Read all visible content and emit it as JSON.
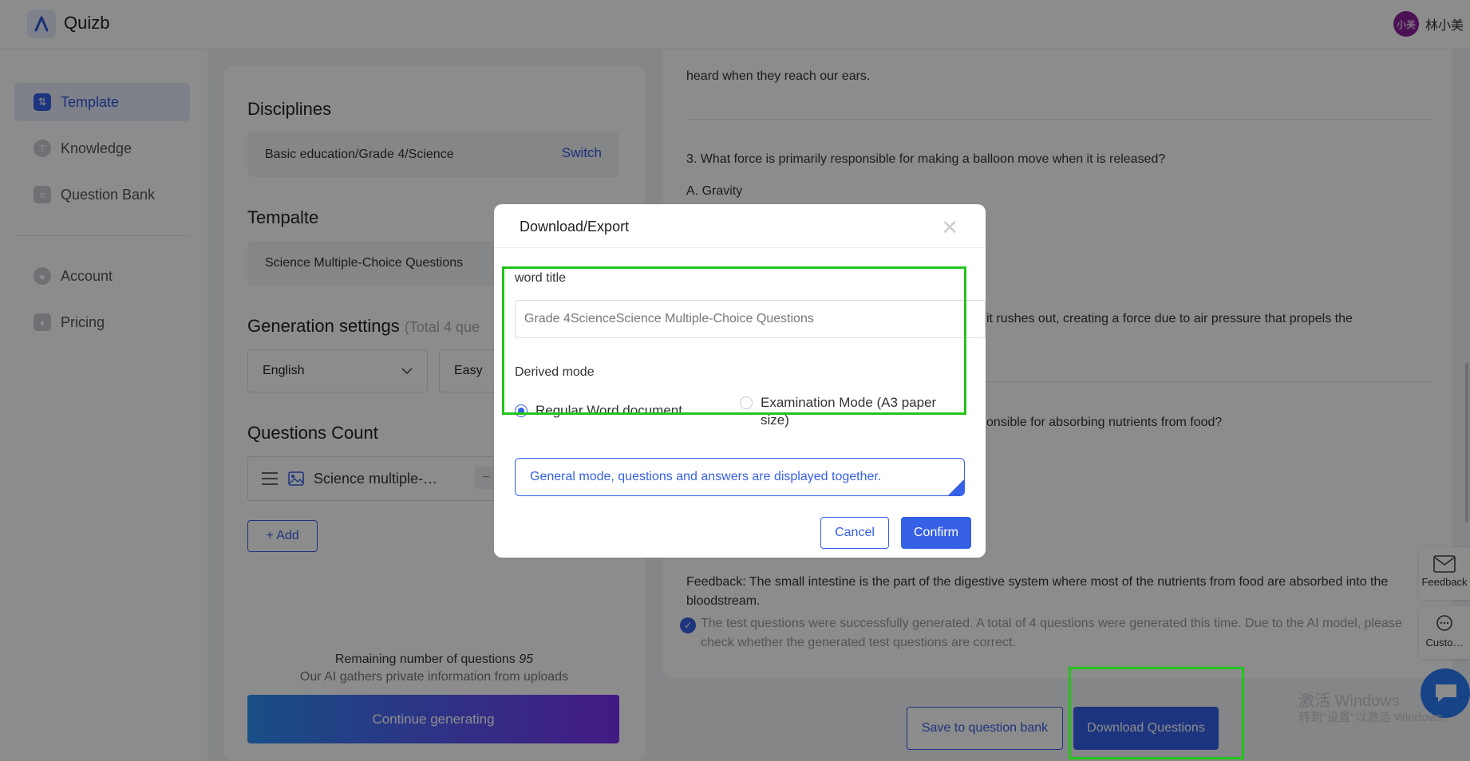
{
  "app": {
    "brand": "Quizb",
    "user_avatar": "小美",
    "user_name": "林小美"
  },
  "sidebar": {
    "items": [
      {
        "label": "Template",
        "icon": "template-icon"
      },
      {
        "label": "Knowledge",
        "icon": "knowledge-icon"
      },
      {
        "label": "Question Bank",
        "icon": "question-bank-icon"
      },
      {
        "label": "Account",
        "icon": "account-icon"
      },
      {
        "label": "Pricing",
        "icon": "pricing-icon"
      }
    ]
  },
  "form": {
    "disciplines_heading": "Disciplines",
    "discipline_value": "Basic education/Grade 4/Science",
    "switch_label": "Switch",
    "template_heading": "Tempalte",
    "template_value": "Science Multiple-Choice Questions",
    "generation_heading": "Generation settings",
    "generation_total": "(Total 4 que",
    "language": "English",
    "difficulty": "Easy",
    "count_heading": "Questions Count",
    "count_item": "Science multiple-…",
    "count_minus": "−",
    "add_label": "+ Add",
    "remaining_label": "Remaining number of questions",
    "remaining_count": "95",
    "gather_note": "Our AI gathers private information from uploads",
    "continue_label": "Continue generating"
  },
  "content": {
    "line_ears": "heard when they reach our ears.",
    "q3": "3. What force is primarily responsible for making a balloon move when it is released?",
    "q3_option_a": "A. Gravity",
    "rushes_out": "it rushes out, creating a force due to air pressure that propels the",
    "absorbing": "onsible for absorbing nutrients from food?",
    "feedback": "Feedback: The small intestine is the part of the digestive system where most of the nutrients from food are absorbed into the bloodstream.",
    "success_msg": "The test questions were successfully generated. A total of 4 questions were generated this time. Due to the AI model, please check whether the generated test questions are correct.",
    "save_label": "Save to question bank",
    "download_label": "Download Questions"
  },
  "floating": {
    "feedback_label": "Feedback",
    "customer_label": "Custo…"
  },
  "watermark": {
    "line1": "激活 Windows",
    "line2": "转到\"设置\"以激活 Windows。"
  },
  "modal": {
    "title": "Download/Export",
    "word_title_label": "word title",
    "word_title_value": "Grade 4ScienceScience Multiple-Choice Questions",
    "derived_mode_label": "Derived mode",
    "option_regular": "Regular Word document",
    "option_exam": "Examination Mode (A3 paper size)",
    "selected_option": "Regular Word document",
    "description": "General mode, questions and answers are displayed together.",
    "cancel_label": "Cancel",
    "confirm_label": "Confirm"
  },
  "colors": {
    "accent": "#3660e6",
    "highlight": "#22c51a",
    "gradient_start": "#2d8ef5",
    "gradient_end": "#7b2ff0"
  }
}
